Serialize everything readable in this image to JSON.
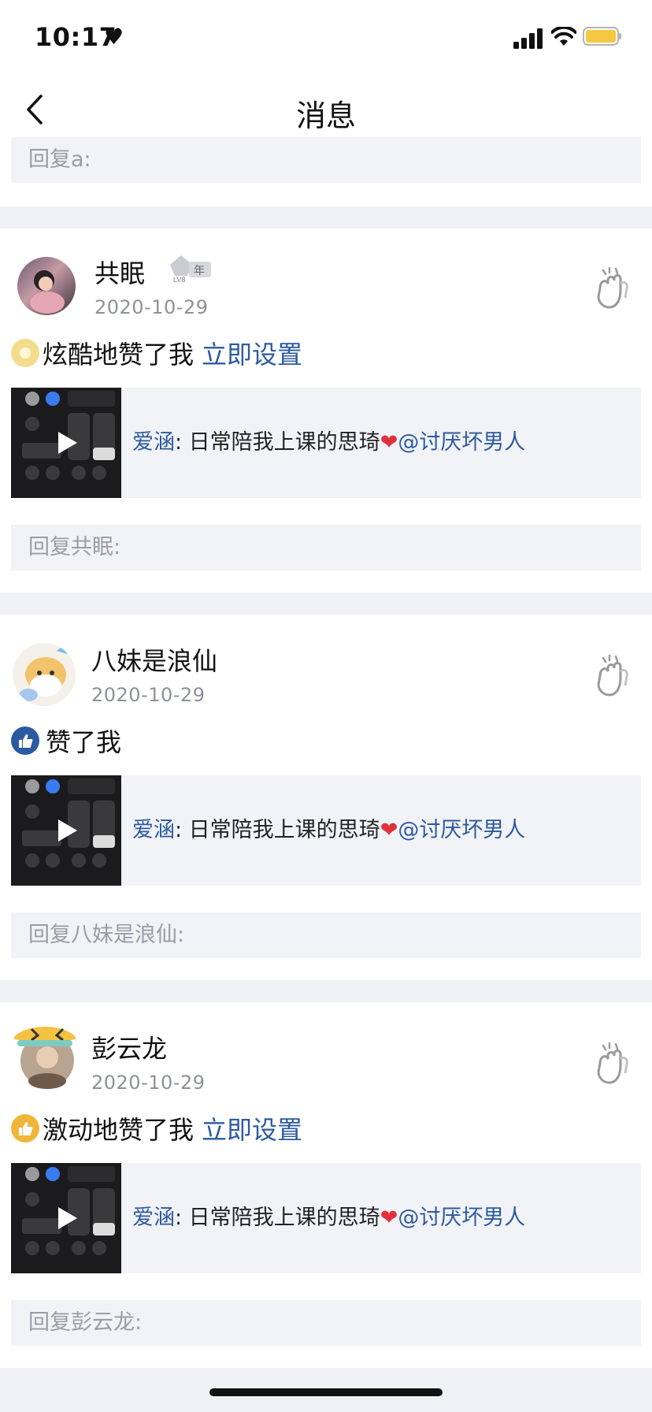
{
  "status_bar": {
    "time": "10:17"
  },
  "nav": {
    "title": "消息"
  },
  "top_reply": {
    "placeholder": "回复a:"
  },
  "items": [
    {
      "username": "共眠",
      "date": "2020-10-29",
      "action_text": "炫酷地赞了我",
      "action_link": "立即设置",
      "quote_author": "爱涵",
      "quote_text": ": 日常陪我上课的思琦",
      "quote_mention": "@讨厌坏男人",
      "reply_placeholder": "回复共眠:",
      "badge_text": "年",
      "badge_level": "LV8"
    },
    {
      "username": "八妹是浪仙",
      "date": "2020-10-29",
      "action_text": "赞了我",
      "action_link": "",
      "quote_author": "爱涵",
      "quote_text": ": 日常陪我上课的思琦",
      "quote_mention": "@讨厌坏男人",
      "reply_placeholder": "回复八妹是浪仙:"
    },
    {
      "username": "彭云龙",
      "date": "2020-10-29",
      "action_text": "激动地赞了我",
      "action_link": "立即设置",
      "quote_author": "爱涵",
      "quote_text": ": 日常陪我上课的思琦",
      "quote_mention": "@讨厌坏男人",
      "reply_placeholder": "回复彭云龙:"
    }
  ],
  "colors": {
    "link": "#2c5aa0",
    "separator": "#f1f2f6",
    "box": "#f2f3f7",
    "battery": "#f5c842"
  }
}
